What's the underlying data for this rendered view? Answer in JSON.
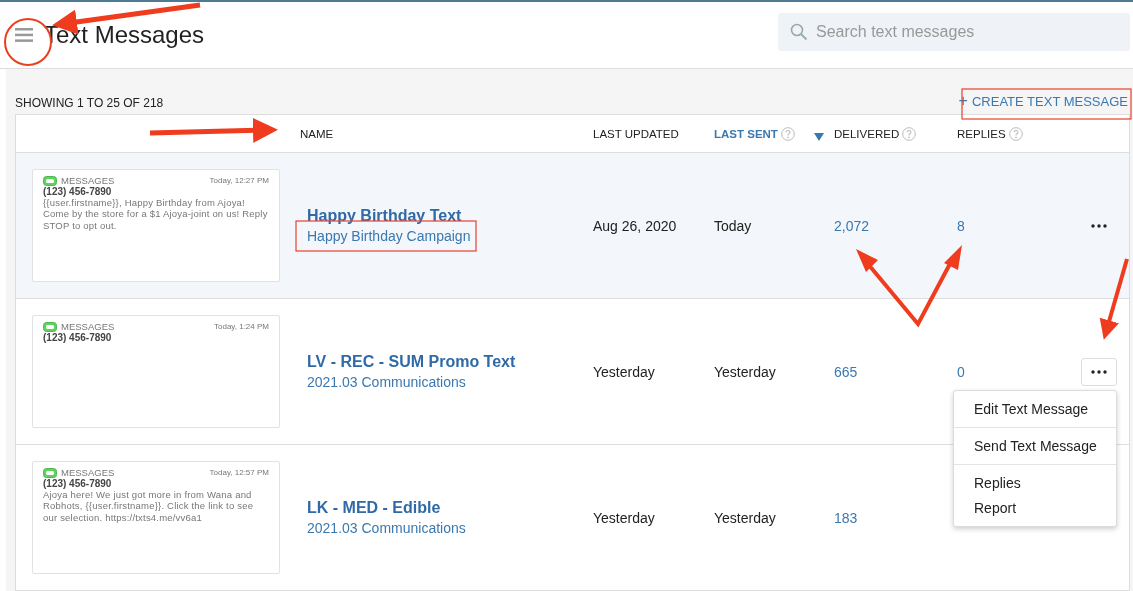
{
  "page": {
    "title": "Text Messages"
  },
  "search": {
    "placeholder": "Search text messages"
  },
  "summary": "SHOWING 1 TO 25 OF 218",
  "create_button": {
    "icon": "+",
    "label": "CREATE TEXT MESSAGE"
  },
  "table": {
    "columns": [
      {
        "label": "NAME",
        "help": false,
        "sorted": false
      },
      {
        "label": "LAST UPDATED",
        "help": false,
        "sorted": false
      },
      {
        "label": "LAST SENT",
        "help": true,
        "sorted": true
      },
      {
        "label": "DELIVERED",
        "help": true,
        "sorted": false
      },
      {
        "label": "REPLIES",
        "help": true,
        "sorted": false
      }
    ],
    "rows": [
      {
        "preview": {
          "app": "MESSAGES",
          "time": "Today, 12:27 PM",
          "phone": "(123) 456-7890",
          "body": "{{user.firstname}}, Happy Birthday from Ajoya! Come by the store for a $1 Ajoya-joint on us! Reply STOP to opt out."
        },
        "name": "Happy Birthday Text",
        "campaign": "Happy Birthday Campaign",
        "last_updated": "Aug 26, 2020",
        "last_sent": "Today",
        "delivered": "2,072",
        "replies": "8",
        "highlighted": true,
        "menu_open": false
      },
      {
        "preview": {
          "app": "MESSAGES",
          "time": "Today, 1:24 PM",
          "phone": "(123) 456-7890"
        },
        "name": "LV - REC - SUM Promo Text",
        "campaign": "2021.03 Communications",
        "last_updated": "Yesterday",
        "last_sent": "Yesterday",
        "delivered": "665",
        "replies": "0",
        "highlighted": false,
        "menu_open": true
      },
      {
        "preview": {
          "app": "MESSAGES",
          "time": "Today, 12:57 PM",
          "phone": "(123) 456-7890",
          "body": "Ajoya here! We just got more in from Wana and Robhots, {{user.firstname}}. Click the link to see our selection. https://txts4.me/vv6a1"
        },
        "name": "LK - MED - Edible",
        "campaign": "2021.03 Communications",
        "last_updated": "Yesterday",
        "last_sent": "Yesterday",
        "delivered": "183",
        "replies": "",
        "highlighted": false,
        "menu_open": false
      }
    ]
  },
  "row_menu": [
    [
      "Edit Text Message"
    ],
    [
      "Send Text Message"
    ],
    [
      "Replies",
      "Report"
    ]
  ]
}
